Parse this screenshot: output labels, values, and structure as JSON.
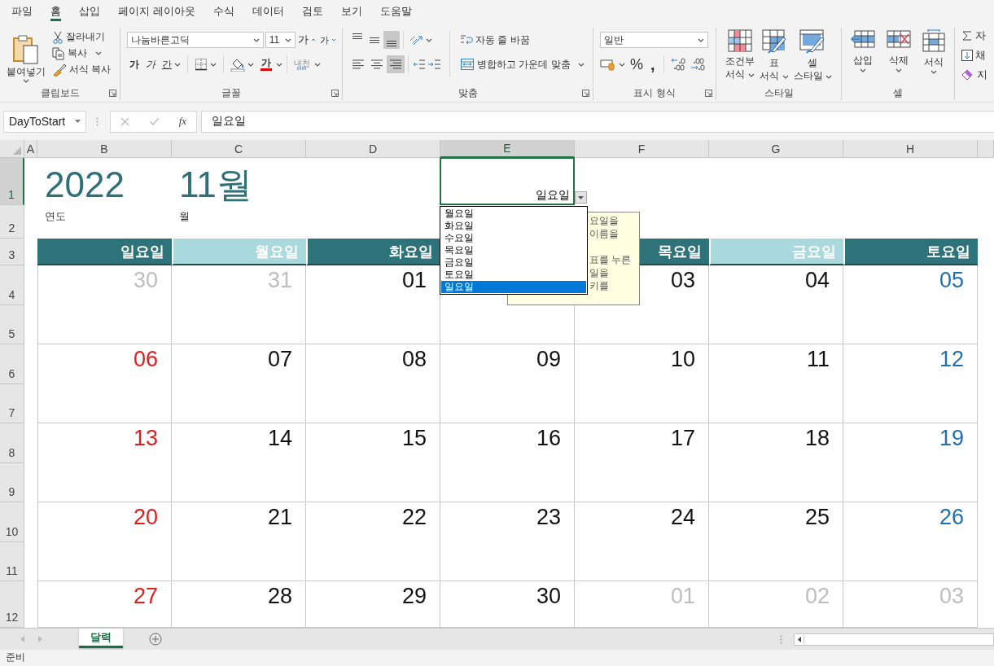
{
  "menu_tabs": [
    {
      "label": "파일",
      "selected": false
    },
    {
      "label": "홈",
      "selected": true
    },
    {
      "label": "삽입",
      "selected": false
    },
    {
      "label": "페이지 레이아웃",
      "selected": false
    },
    {
      "label": "수식",
      "selected": false
    },
    {
      "label": "데이터",
      "selected": false
    },
    {
      "label": "검토",
      "selected": false
    },
    {
      "label": "보기",
      "selected": false
    },
    {
      "label": "도움말",
      "selected": false
    }
  ],
  "ribbon": {
    "clipboard": {
      "title": "클립보드",
      "paste": "붙여넣기",
      "cut": "잘라내기",
      "copy": "복사",
      "format_painter": "서식 복사"
    },
    "font": {
      "title": "글꼴",
      "font_name": "나눔바른고딕",
      "font_size": "11",
      "grow": "가",
      "shrink": "가",
      "bold": "가",
      "italic": "가",
      "underline": "간",
      "font_color": "가",
      "phonetic": "내천"
    },
    "alignment": {
      "title": "맞춤",
      "vertical": [
        {
          "selected": false
        },
        {
          "selected": false
        },
        {
          "selected": true
        }
      ],
      "horizontal": [
        {
          "selected": false
        },
        {
          "selected": false
        },
        {
          "selected": true
        }
      ],
      "wrap_text": "자동 줄 바꿈",
      "merge_center": "병합하고 가운데 맞춤"
    },
    "number": {
      "title": "표시 형식",
      "format": "일반",
      "percent": "%",
      "comma": ","
    },
    "styles": {
      "title": "스타일",
      "buttons": [
        {
          "kind": "conditional",
          "lines": [
            "조건부",
            "서식"
          ]
        },
        {
          "kind": "table",
          "lines": [
            "표",
            "서식"
          ]
        },
        {
          "kind": "cell",
          "lines": [
            "셀",
            "스타일"
          ]
        }
      ]
    },
    "cells": {
      "title": "셀",
      "buttons": [
        {
          "kind": "insert",
          "label": "삽입"
        },
        {
          "kind": "delete",
          "label": "삭제"
        },
        {
          "kind": "format",
          "label": "서식"
        }
      ]
    },
    "editing": {
      "items": [
        {
          "kind": "sum",
          "label": "자"
        },
        {
          "kind": "fill",
          "label": "채"
        },
        {
          "kind": "clear",
          "label": "지"
        }
      ]
    }
  },
  "formula_bar": {
    "name_box": "DayToStart",
    "function_label": "fx",
    "formula": "일요일"
  },
  "sheet": {
    "columns": [
      {
        "label": "A",
        "selected": false
      },
      {
        "label": "B",
        "selected": false
      },
      {
        "label": "C",
        "selected": false
      },
      {
        "label": "D",
        "selected": false
      },
      {
        "label": "E",
        "selected": true
      },
      {
        "label": "F",
        "selected": false
      },
      {
        "label": "G",
        "selected": false
      },
      {
        "label": "H",
        "selected": false
      }
    ],
    "rows": [
      {
        "label": "1",
        "selected": true
      },
      {
        "label": "2",
        "selected": false
      },
      {
        "label": "3",
        "selected": false
      },
      {
        "label": "4",
        "selected": false
      },
      {
        "label": "5",
        "selected": false
      },
      {
        "label": "6",
        "selected": false
      },
      {
        "label": "7",
        "selected": false
      },
      {
        "label": "8",
        "selected": false
      },
      {
        "label": "9",
        "selected": false
      },
      {
        "label": "10",
        "selected": false
      },
      {
        "label": "11",
        "selected": false
      },
      {
        "label": "12",
        "selected": false
      }
    ],
    "year": "2022",
    "year_caption": "연도",
    "month": "11월",
    "month_caption": "월",
    "selected_cell_value": "일요일",
    "day_headers": [
      {
        "kind": "dark",
        "label": "일요일"
      },
      {
        "kind": "light",
        "label": "월요일"
      },
      {
        "kind": "dark",
        "label": "화요일"
      },
      {
        "kind": "light"
      },
      {
        "kind": "dark",
        "label": "목요일"
      },
      {
        "kind": "light",
        "label": "금요일"
      },
      {
        "kind": "dark",
        "label": "토요일"
      }
    ],
    "weeks": [
      [
        {
          "kind": "date",
          "day": "30",
          "in_month": false
        },
        {
          "kind": "date",
          "day": "31",
          "in_month": false
        },
        {
          "kind": "date",
          "day": "01",
          "in_month": true
        },
        {
          "kind": "covered"
        },
        {
          "kind": "date",
          "day": "03",
          "in_month": true
        },
        {
          "kind": "date",
          "day": "04",
          "in_month": true
        },
        {
          "kind": "date",
          "day": "05",
          "in_month": true
        }
      ],
      [
        {
          "kind": "date",
          "day": "06",
          "in_month": true
        },
        {
          "kind": "date",
          "day": "07",
          "in_month": true
        },
        {
          "kind": "date",
          "day": "08",
          "in_month": true
        },
        {
          "kind": "date",
          "day": "09",
          "in_month": true
        },
        {
          "kind": "date",
          "day": "10",
          "in_month": true
        },
        {
          "kind": "date",
          "day": "11",
          "in_month": true
        },
        {
          "kind": "date",
          "day": "12",
          "in_month": true
        }
      ],
      [
        {
          "kind": "date",
          "day": "13",
          "in_month": true
        },
        {
          "kind": "date",
          "day": "14",
          "in_month": true
        },
        {
          "kind": "date",
          "day": "15",
          "in_month": true
        },
        {
          "kind": "date",
          "day": "16",
          "in_month": true
        },
        {
          "kind": "date",
          "day": "17",
          "in_month": true
        },
        {
          "kind": "date",
          "day": "18",
          "in_month": true
        },
        {
          "kind": "date",
          "day": "19",
          "in_month": true
        }
      ],
      [
        {
          "kind": "date",
          "day": "20",
          "in_month": true
        },
        {
          "kind": "date",
          "day": "21",
          "in_month": true
        },
        {
          "kind": "date",
          "day": "22",
          "in_month": true
        },
        {
          "kind": "date",
          "day": "23",
          "in_month": true
        },
        {
          "kind": "date",
          "day": "24",
          "in_month": true
        },
        {
          "kind": "date",
          "day": "25",
          "in_month": true
        },
        {
          "kind": "date",
          "day": "26",
          "in_month": true
        }
      ],
      [
        {
          "kind": "date",
          "day": "27",
          "in_month": true
        },
        {
          "kind": "date",
          "day": "28",
          "in_month": true
        },
        {
          "kind": "date",
          "day": "29",
          "in_month": true
        },
        {
          "kind": "date",
          "day": "30",
          "in_month": true
        },
        {
          "kind": "date",
          "day": "01",
          "in_month": false
        },
        {
          "kind": "date",
          "day": "02",
          "in_month": false
        },
        {
          "kind": "date",
          "day": "03",
          "in_month": false
        }
      ]
    ]
  },
  "dropdown": {
    "items": [
      {
        "label": "월요일",
        "selected": false
      },
      {
        "label": "화요일",
        "selected": false
      },
      {
        "label": "수요일",
        "selected": false
      },
      {
        "label": "목요일",
        "selected": false
      },
      {
        "label": "금요일",
        "selected": false
      },
      {
        "label": "토요일",
        "selected": false
      },
      {
        "label": "일요일",
        "selected": true
      }
    ]
  },
  "tooltip": {
    "paragraphs": [
      [
        "요일을",
        "이름을"
      ],
      [
        "표를 누른",
        "일을",
        "키를"
      ]
    ]
  },
  "sheet_tabs": [
    {
      "label": "달력",
      "selected": true
    }
  ],
  "status_bar": {
    "text": "준비"
  }
}
